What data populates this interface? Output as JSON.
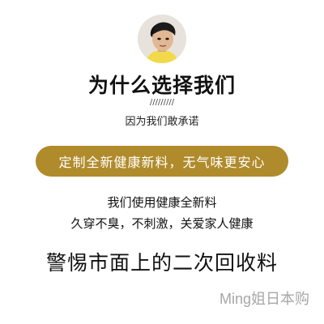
{
  "header": {
    "title": "为什么选择我们",
    "divider_text": "/////////",
    "subtitle": "因为我们敢承诺"
  },
  "banner": {
    "text": "定制全新健康新料，无气味更安心"
  },
  "body": {
    "line1": "我们使用健康全新料",
    "line2": "久穿不臭，不刺激，关爱家人健康",
    "emphasis": "警惕市面上的二次回收料"
  },
  "watermark": {
    "text": "Ming姐日本购"
  },
  "colors": {
    "banner_bg": "#b08b2c",
    "banner_text": "#ffffff",
    "text_primary": "#111111"
  },
  "icons": {
    "avatar": "profile-photo"
  }
}
